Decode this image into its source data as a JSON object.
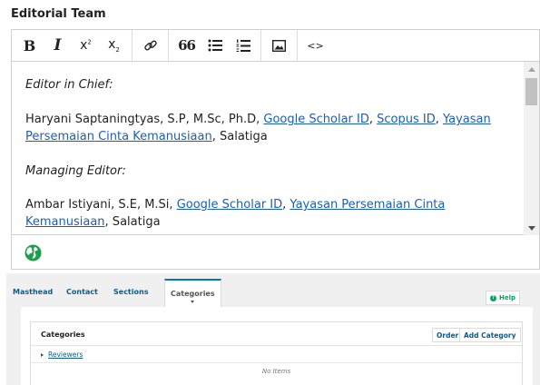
{
  "section": {
    "title": "Editorial Team"
  },
  "toolbar": {
    "bold": "B",
    "italic": "I",
    "superscript_base": "x",
    "superscript_mark": "2",
    "subscript_base": "x",
    "subscript_mark": "2",
    "quote": "66",
    "code": "<>",
    "icons": [
      "bold-icon",
      "italic-icon",
      "superscript-icon",
      "subscript-icon",
      "link-icon",
      "blockquote-icon",
      "bullet-list-icon",
      "numbered-list-icon",
      "image-icon",
      "source-code-icon"
    ]
  },
  "content": {
    "p1": {
      "text": "Editor in Chief:"
    },
    "p2": {
      "text_before": "Haryani Saptaningtyas, S.P, M.Sc, Ph.D, ",
      "link1": "Google Scholar ID",
      "sep1": ", ",
      "link2": "Scopus ID",
      "sep2": ", ",
      "link3": "Yayasan Persemaian Cinta Kemanusiaan",
      "text_after": ", Salatiga"
    },
    "p3": {
      "text": "Managing Editor:"
    },
    "p4": {
      "text_before": "Ambar Istiyani, S.E, M.Si, ",
      "link1": "Google Scholar ID",
      "sep1": ", ",
      "link2": "Yayasan Persemaian Cinta Kemanusiaan",
      "text_after": ", Salatiga"
    }
  },
  "footer": {
    "icon": "globe-icon",
    "icon_color": "#1e9e4a"
  },
  "panel": {
    "tabs": [
      {
        "label": "Masthead"
      },
      {
        "label": "Contact"
      },
      {
        "label": "Sections"
      },
      {
        "label": "Categories",
        "active": true
      }
    ],
    "help_label": "Help",
    "help_mark": "?",
    "list": {
      "title": "Categories",
      "order_label": "Order",
      "add_label": "Add Category",
      "items": [
        {
          "label": "Reviewers"
        }
      ],
      "empty_text": "No Items"
    }
  },
  "colors": {
    "link": "#1a5fb4",
    "accent": "#007ab2",
    "help": "#00a65a",
    "tab_link": "#0b5c8a"
  }
}
